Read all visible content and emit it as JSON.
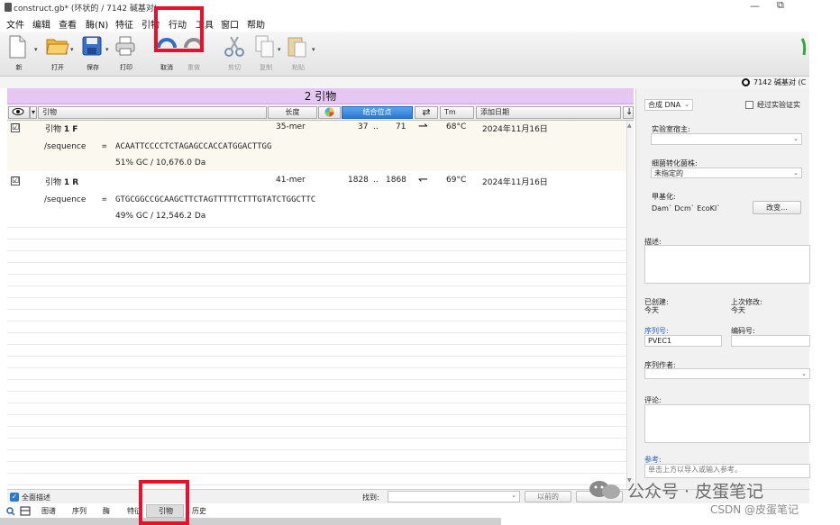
{
  "window": {
    "title": "construct.gb* (环状的 / 7142 碱基对)"
  },
  "menubar": {
    "items": [
      "文件",
      "编辑",
      "查看",
      "酶(N)",
      "特征",
      "引物",
      "行动",
      "工具",
      "窗口",
      "帮助"
    ]
  },
  "toolbar": {
    "new_label": "新",
    "open_label": "打开",
    "save_label": "保存",
    "print_label": "打印",
    "undo_label": "取消",
    "redo_label": "重做",
    "cut_label": "剪切",
    "copy_label": "复制",
    "paste_label": "粘贴"
  },
  "status": {
    "bp_text": "7142 碱基对 (C"
  },
  "primer_panel": {
    "title": "2 引物",
    "columns": {
      "primer": "引物",
      "length": "长度",
      "binding": "结合位点",
      "tm": "Tm",
      "date": "添加日期"
    },
    "primers": [
      {
        "name_prefix": "引物",
        "name_bold": "1 F",
        "length": "35-mer",
        "start": "37",
        "range_sep": "..",
        "end": "71",
        "direction": "⇀",
        "tm": "68°C",
        "date": "2024年11月16日",
        "seq_key": "/sequence",
        "seq_eq": "=",
        "sequence": "ACAATTCCCCTCTAGAGCCACCATGGACTTGG",
        "stats": "51% GC  /  10,676.0 Da",
        "checked": "☑"
      },
      {
        "name_prefix": "引物",
        "name_bold": "1 R",
        "length": "41-mer",
        "start": "1828",
        "range_sep": "..",
        "end": "1868",
        "direction": "↽",
        "tm": "69°C",
        "date": "2024年11月16日",
        "seq_key": "/sequence",
        "seq_eq": "=",
        "sequence": "GTGCGGCCGCAAGCTTCTAGTTTTTCTTTGTATCTGGCTTC",
        "stats": "49% GC  /  12,546.2 Da",
        "checked": "☑"
      }
    ]
  },
  "right_panel": {
    "type_select": "合成 DNA",
    "verified_label": "经过实验证实",
    "lab_host_label": "实验室宿主:",
    "lab_host_value": "",
    "strain_label": "细菌转化菌株:",
    "strain_value": "未指定的",
    "methylation_label": "甲基化:",
    "methylation_value": "Dam`  Dcm`  EcoKI`",
    "change_button": "改变...",
    "description_label": "描述:",
    "created_label": "已创建:",
    "created_value": "今天",
    "modified_label": "上次修改:",
    "modified_value": "今天",
    "seq_no_label": "序列号:",
    "seq_no_value": "PVEC1",
    "code_label": "编码号:",
    "author_label": "序列作者:",
    "comment_label": "评论:",
    "reference_label": "参考:",
    "reference_hint": "单击上方以导入或输入参考。"
  },
  "find_bar": {
    "full_desc_label": "全面描述",
    "find_label": "找到:",
    "prev_button": "以前的"
  },
  "tabs": {
    "items": [
      "图谱",
      "序列",
      "酶",
      "特征",
      "引物",
      "历史"
    ],
    "active": "引物"
  },
  "watermark": {
    "main": "公众号 · 皮蛋笔记",
    "csdn": "CSDN @皮蛋笔记"
  },
  "highlight_color": "#e8102a"
}
